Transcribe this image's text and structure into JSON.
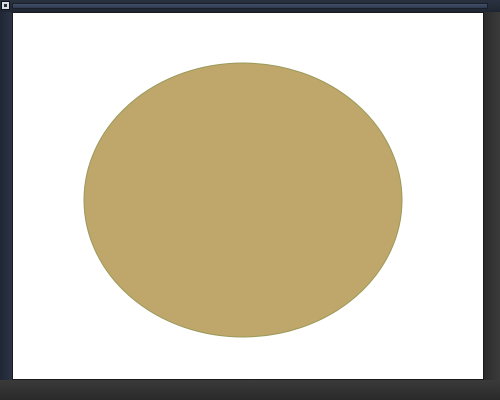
{
  "window": {
    "title": ""
  },
  "canvas": {
    "background": "#ffffff",
    "shape": {
      "type": "ellipse",
      "fill": "#bfa76c",
      "stroke": "#9a9a5a"
    }
  },
  "icons": {
    "app_icon": "app-icon"
  }
}
